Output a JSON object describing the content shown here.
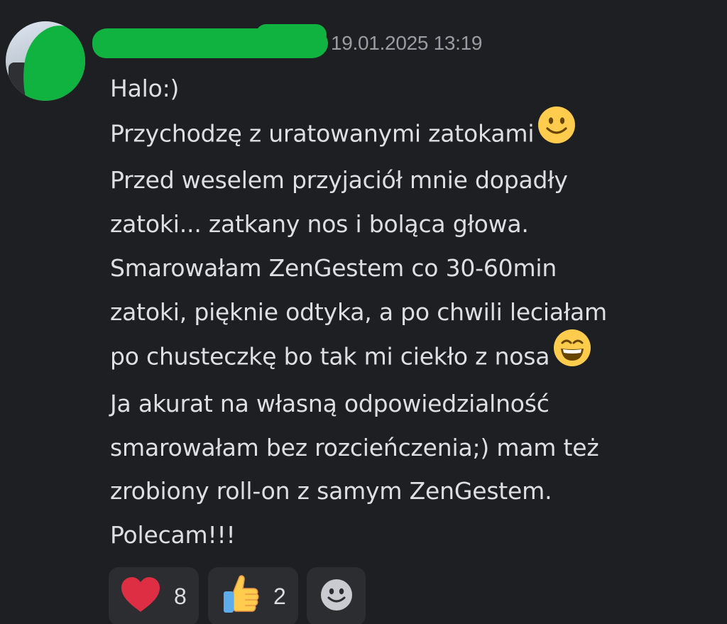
{
  "message": {
    "timestamp": "19.01.2025 13:19",
    "lines": [
      "Halo:)",
      "Przychodzę z uratowanymi zatokami",
      "Przed weselem przyjaciół mnie dopadły",
      "zatoki... zatkany nos i boląca głowa.",
      "Smarowałam ZenGestem co 30-60min",
      "zatoki, pięknie odtyka, a po chwili leciałam",
      "po chusteczkę bo tak mi ciekło z nosa",
      "Ja akurat na własną odpowiedzialność",
      "smarowałam bez rozcieńczenia;) mam też",
      "zrobiony roll-on z samym ZenGestem.",
      "Polecam!!!"
    ],
    "inline_emojis": [
      "slightly-smiling-face",
      "grinning-face-with-smiling-eyes"
    ]
  },
  "reactions": [
    {
      "icon": "heart",
      "count": "8"
    },
    {
      "icon": "thumbs-up",
      "count": "2"
    },
    {
      "icon": "add-reaction"
    }
  ],
  "colors": {
    "background": "#1e1f23",
    "text": "#dedfe3",
    "timestamp": "#9a9ca3",
    "reaction_bg": "#2b2d31",
    "redaction_green": "#10b240",
    "heart_red": "#dd2e44",
    "emoji_yellow": "#ffcc4d"
  }
}
